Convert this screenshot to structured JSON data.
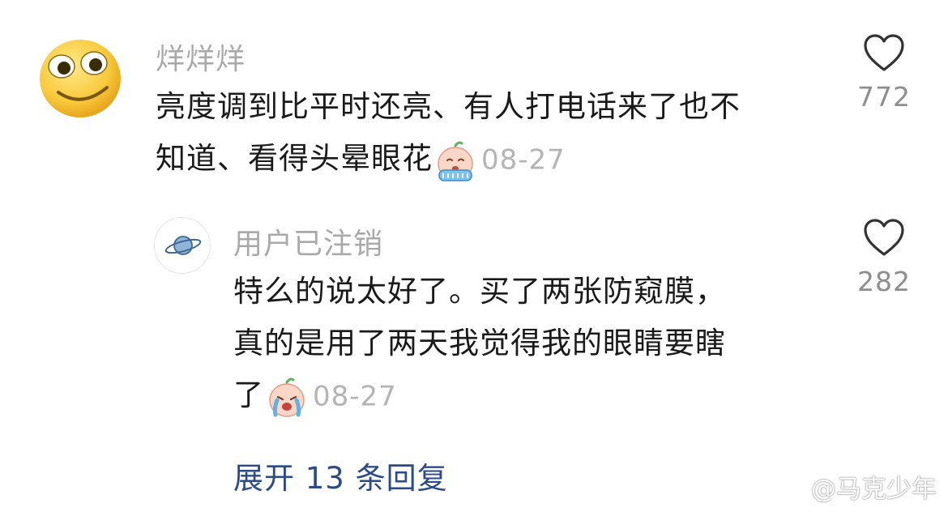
{
  "comment": {
    "username": "烊烊烊",
    "lines": [
      "亮度调到比平时还亮、有人打电话来了也不",
      "知道、看得头晕眼花"
    ],
    "date": "08-27",
    "likes": "772"
  },
  "reply": {
    "username": "用户已注销",
    "lines": [
      "特么的说太好了。买了两张防窥膜，",
      "真的是用了两天我觉得我的眼睛要瞎",
      "了"
    ],
    "date": "08-27",
    "likes": "282"
  },
  "expand_label": "展开 13 条回复",
  "watermark": "@马克少年",
  "colors": {
    "username": "#a9a9a9",
    "text": "#1a1a1a",
    "date": "#b4b4b4",
    "link": "#2b4a86"
  },
  "icons": [
    "smiley-avatar-icon",
    "planet-avatar-icon",
    "heart-icon",
    "crying-emoji-icon",
    "weibo-logo-icon"
  ]
}
